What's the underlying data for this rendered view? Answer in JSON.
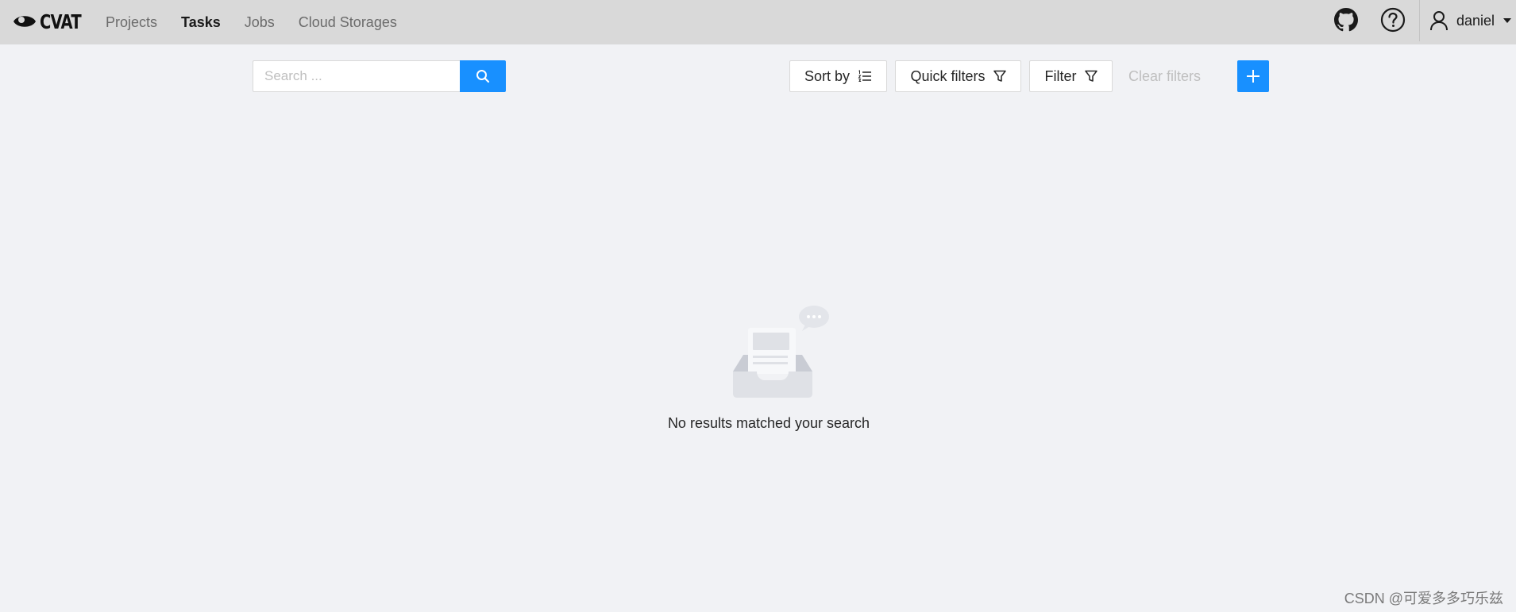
{
  "app": {
    "logo_text": "CVAT"
  },
  "nav": {
    "items": [
      {
        "label": "Projects",
        "active": false
      },
      {
        "label": "Tasks",
        "active": true
      },
      {
        "label": "Jobs",
        "active": false
      },
      {
        "label": "Cloud Storages",
        "active": false
      }
    ]
  },
  "header_icons": {
    "github": "github-icon",
    "help": "question-circle-icon",
    "user": "user-icon",
    "caret": "caret-down-icon"
  },
  "user": {
    "name": "daniel"
  },
  "toolbar": {
    "search_placeholder": "Search ...",
    "search_value": "",
    "sort_label": "Sort by",
    "quick_filters_label": "Quick filters",
    "filter_label": "Filter",
    "clear_filters_label": "Clear filters"
  },
  "empty_state": {
    "message": "No results matched your search",
    "icon": "empty-inbox-icon"
  },
  "watermark": "CSDN @可爱多多巧乐兹",
  "colors": {
    "primary": "#1890ff",
    "header_bg": "#d9d9d9",
    "page_bg": "#f1f2f5",
    "disabled_text": "#bfbfbf"
  }
}
